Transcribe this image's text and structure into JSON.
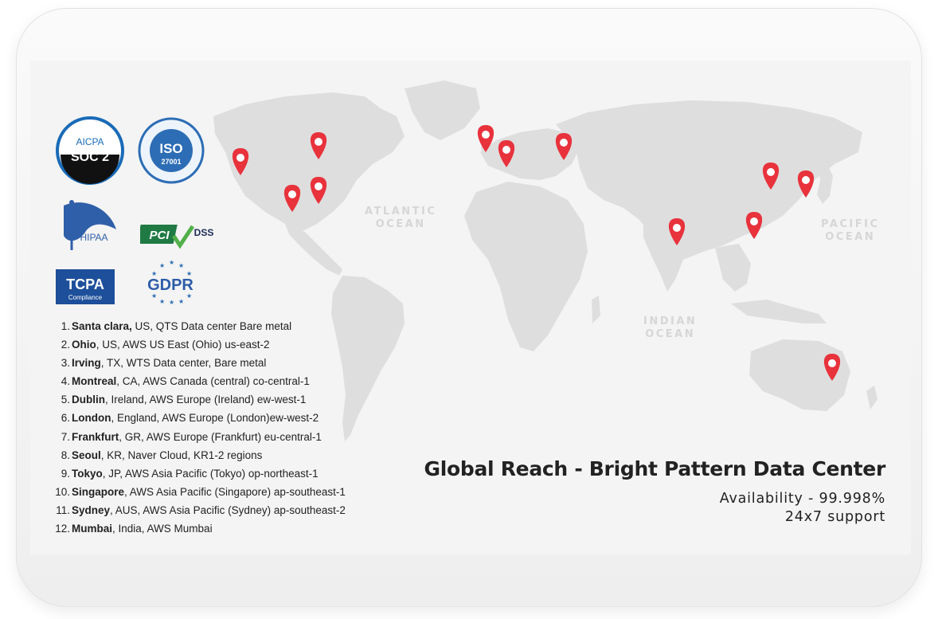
{
  "badges": {
    "soc2": {
      "top_text": "AICPA",
      "main": "SOC 2"
    },
    "iso": {
      "main": "ISO",
      "number": "27001"
    },
    "hipaa": {
      "text": "HIPAA"
    },
    "pci": {
      "main": "PCI",
      "dss": "DSS"
    },
    "tcpa": {
      "main": "TCPA",
      "sub": "Compliance"
    },
    "gdpr": {
      "main": "GDPR"
    }
  },
  "oceans": {
    "atlantic": "ATLANTIC\nOCEAN",
    "indian": "INDIAN\nOCEAN",
    "pacific": "PACIFIC\nOCEAN"
  },
  "locations": [
    {
      "num": "1.",
      "city": "Santa clara,",
      "detail": " US, QTS Data center Bare metal"
    },
    {
      "num": "2.",
      "city": "Ohio",
      "detail": ", US, AWS US East (Ohio) us-east-2"
    },
    {
      "num": "3.",
      "city": "Irving",
      "detail": ", TX, WTS Data center, Bare metal"
    },
    {
      "num": "4.",
      "city": "Montreal",
      "detail": ", CA, AWS Canada (central) co-central-1"
    },
    {
      "num": "5.",
      "city": "Dublin",
      "detail": ", Ireland, AWS Europe (Ireland) ew-west-1"
    },
    {
      "num": "6.",
      "city": "London",
      "detail": ", England, AWS Europe (London)ew-west-2"
    },
    {
      "num": "7.",
      "city": "Frankfurt",
      "detail": ", GR, AWS Europe (Frankfurt) eu-central-1"
    },
    {
      "num": "8.",
      "city": "Seoul",
      "detail": ", KR, Naver Cloud, KR1-2 regions"
    },
    {
      "num": "9.",
      "city": "Tokyo",
      "detail": ", JP, AWS Asia Pacific (Tokyo) op-northeast-1"
    },
    {
      "num": "10.",
      "city": "Singapore",
      "detail": ", AWS Asia Pacific (Singapore) ap-southeast-1"
    },
    {
      "num": "11.",
      "city": "Sydney",
      "detail": ", AUS, AWS Asia Pacific (Sydney) ap-southeast-2"
    },
    {
      "num": "12.",
      "city": "Mumbai",
      "detail": ", India, AWS Mumbai"
    }
  ],
  "headline": {
    "title": "Global Reach - Bright Pattern Data Center",
    "availability": "Availability - 99.998%",
    "support": "24x7 support"
  },
  "colors": {
    "pin": "#e8323c",
    "land": "#dedede",
    "screen_bg": "#f4f4f4"
  }
}
